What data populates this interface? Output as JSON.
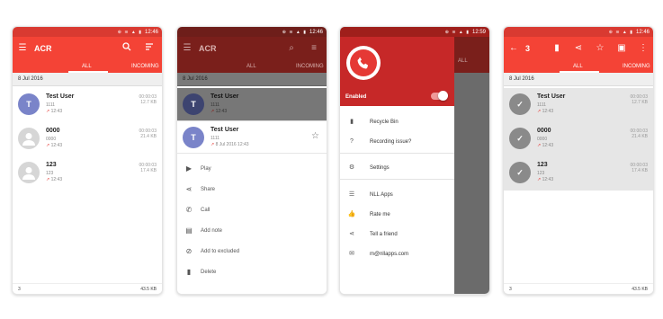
{
  "statusbar": {
    "icons": "⊕ ≋ ▲ ▮",
    "time1": "12:46",
    "time3": "12:59"
  },
  "app": {
    "title": "ACR",
    "selection_count": "3"
  },
  "tabs": {
    "all": "ALL",
    "incoming": "INCOMING"
  },
  "date_header": "8 Jul 2016",
  "calls": [
    {
      "avatar": "T",
      "name": "Test User",
      "number": "1111",
      "time": "12:43",
      "duration": "00:00:03",
      "size": "12.7 KB"
    },
    {
      "avatar": "",
      "name": "0000",
      "number": "0000",
      "time": "12:43",
      "duration": "00:00:03",
      "size": "21.4 KB"
    },
    {
      "avatar": "",
      "name": "123",
      "number": "123",
      "time": "12:43",
      "duration": "00:00:03",
      "size": "17.4 KB"
    }
  ],
  "footer": {
    "count": "3",
    "total_size": "43.5 KB"
  },
  "sheet": {
    "contact_name": "Test User",
    "contact_number": "1111",
    "contact_datetime": "8 Jul 2016 12:43",
    "items": [
      {
        "label": "Play",
        "icon": "▶"
      },
      {
        "label": "Share",
        "icon": "⋖"
      },
      {
        "label": "Call",
        "icon": "✆"
      },
      {
        "label": "Add note",
        "icon": "▤"
      },
      {
        "label": "Add to excluded",
        "icon": "⊘"
      },
      {
        "label": "Delete",
        "icon": "▮"
      }
    ]
  },
  "drawer": {
    "enabled_label": "Enabled",
    "items": [
      {
        "label": "Recycle Bin",
        "icon": "▮"
      },
      {
        "label": "Recording issue?",
        "icon": "?"
      },
      {
        "label": "Settings",
        "icon": "⚙"
      },
      {
        "label": "NLL Apps",
        "icon": "☰"
      },
      {
        "label": "Rate me",
        "icon": "👍"
      },
      {
        "label": "Tell a friend",
        "icon": "⋖"
      },
      {
        "label": "m@nllapps.com",
        "icon": "✉"
      }
    ]
  },
  "colors": {
    "toolbar": "#f44336",
    "statusbar": "#d93a31",
    "drawer_header": "#c62828",
    "accent": "#e53935"
  }
}
